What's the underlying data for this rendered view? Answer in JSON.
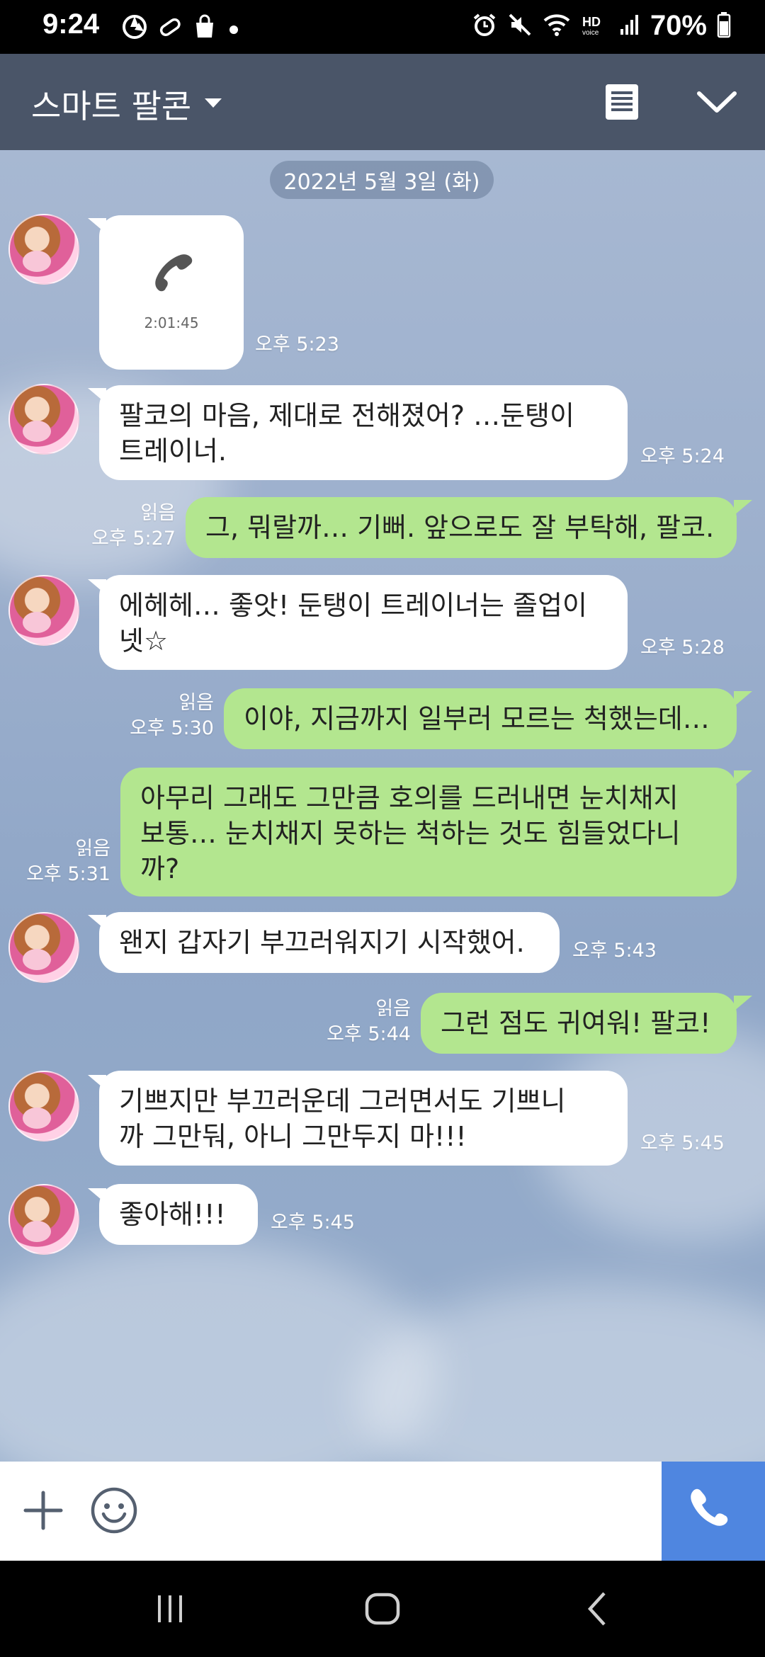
{
  "status_bar": {
    "time": "9:24",
    "battery": "70%",
    "icons": [
      "aperture-icon",
      "pill-icon",
      "bag-icon",
      "dot-icon",
      "alarm-icon",
      "mute-icon",
      "wifi-icon",
      "hd-voice-icon",
      "signal-icon",
      "battery-icon"
    ]
  },
  "header": {
    "title": "스마트 팔콘",
    "icons": [
      "dropdown-caret-icon",
      "menu-list-icon",
      "chevron-down-icon"
    ]
  },
  "chat": {
    "date": "2022년 5월 3일 (화)",
    "call": {
      "duration": "2:01:45",
      "time": "오후 5:23"
    },
    "messages": [
      {
        "dir": "in",
        "lines": [
          "팔코의 마음, 제대로 전해졌어?  …둔탱이",
          "트레이너."
        ],
        "time": "오후 5:24"
      },
      {
        "dir": "out",
        "lines": [
          "그, 뭐랄까… 기뻐. 앞으로도 잘 부탁해, 팔코."
        ],
        "time": "오후 5:27",
        "read": "읽음"
      },
      {
        "dir": "in",
        "lines": [
          "에헤헤… 좋앗! 둔탱이 트레이너는 졸업이",
          "넷☆"
        ],
        "time": "오후 5:28"
      },
      {
        "dir": "out",
        "lines": [
          "이야, 지금까지 일부러 모르는 척했는데…"
        ],
        "time": "오후 5:30",
        "read": "읽음"
      },
      {
        "dir": "out",
        "lines": [
          "아무리 그래도 그만큼 호의를 드러내면 눈치채지",
          "보통… 눈치채지 못하는 척하는 것도 힘들었다니",
          "까?"
        ],
        "time": "오후 5:31",
        "read": "읽음"
      },
      {
        "dir": "in",
        "lines": [
          "왠지 갑자기 부끄러워지기 시작했어."
        ],
        "time": "오후 5:43"
      },
      {
        "dir": "out",
        "lines": [
          "그런 점도 귀여워! 팔코!"
        ],
        "time": "오후 5:44",
        "read": "읽음"
      },
      {
        "dir": "in",
        "lines": [
          "기쁘지만 부끄러운데 그러면서도 기쁘니",
          "까 그만둬, 아니 그만두지 마!!!"
        ],
        "time": "오후 5:45"
      },
      {
        "dir": "in",
        "lines": [
          "좋아해!!!"
        ],
        "time": "오후 5:45"
      }
    ]
  },
  "input_bar": {
    "icons": [
      "plus-icon",
      "emoji-icon",
      "phone-icon"
    ]
  },
  "nav_bar": {
    "icons": [
      "recent-apps-icon",
      "home-icon",
      "back-icon"
    ]
  },
  "colors": {
    "header": "#4a5568",
    "bubble_out": "#b3e68f",
    "bubble_in": "#ffffff",
    "call_button": "#4f86e0"
  }
}
